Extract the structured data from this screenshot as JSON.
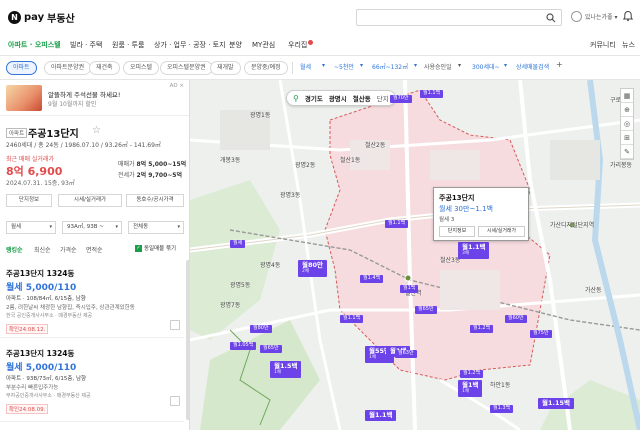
{
  "header": {
    "logo_n": "N",
    "logo_pay": "pay",
    "logo_service": "부동산",
    "search_placeholder": "",
    "user_name": "있나는가좋 ▾"
  },
  "nav": {
    "items": [
      "아파트 · 오피스텔",
      "빌라 · 주택",
      "원룸 · 투룸",
      "상가 · 업무 · 공장 · 토지",
      "분양",
      "MY관심",
      "우리집"
    ],
    "active_index": 0,
    "right": [
      "커뮤니티",
      "뉴스"
    ]
  },
  "filters": {
    "chips": [
      "아파트",
      "아파트분양권",
      "재건축",
      "오피스텔",
      "오피스텔분양권",
      "재개발",
      "분양중/예정"
    ],
    "active_chip": 0,
    "trade": "월세",
    "price": "~5천만",
    "area": "66㎡~132㎡",
    "approval": "사용승인일",
    "households": "300세대~",
    "more": "상세매물검색",
    "plus": "+"
  },
  "ad": {
    "title": "알뜰하게 주석선물 하세요!",
    "subtitle": "9월 10월까지 할인",
    "tag": "AD ×"
  },
  "complex": {
    "badge": "아파트",
    "name": "주공13단지",
    "star": "☆",
    "info": "2460세대 / 총 24동 / 1986.07.10 / 93.26㎡ - 141.69㎡",
    "recent_label": "최근 매매 실거래가",
    "recent_price": "8억 6,900",
    "recent_date": "2024.07.31. 15층, 93㎡",
    "sale_label": "매매가",
    "sale_value": "8억 5,000~15억",
    "lease_label": "전세가",
    "lease_value": "2억 9,700~5억",
    "buttons": [
      "단지정보",
      "시세/실거래가",
      "동호수/공시가격"
    ]
  },
  "selectors": {
    "type": "월세",
    "area": "93A㎡, 93B ~",
    "dong": "전체동"
  },
  "sort_tabs": [
    "랭킹순",
    "최신순",
    "가격순",
    "면적순"
  ],
  "group_label": "동일매물 묶기",
  "listings": [
    {
      "title": "주공13단지 1324동",
      "price": "월세 5,000/110",
      "line1": "아파트 · 108/84㎡, 6/15층, 남향",
      "line2": "2룸, 려한날씨 채광한 남향집, 즉시입주, 상관관계있한동",
      "line3": "한국 공인중개사사무소 · 매경부동산 제공",
      "confirm": "확인24.08.12."
    },
    {
      "title": "주공13단지 1324동",
      "price": "월세 5,000/110",
      "line1": "아파트 · 93B/73㎡, 6/15층, 남향",
      "line2": "부분수리 빠른입주가능",
      "line3": "부자공인중개사사무소 · 매경부동산 제공",
      "confirm": "확인24.08.09."
    }
  ],
  "map": {
    "address": [
      "경기도",
      "광명시",
      "철산동"
    ],
    "address_extra": "단지",
    "tools": [
      "▦",
      "⊕",
      "◎",
      "⊞",
      "✎"
    ],
    "labels": [
      {
        "name": "map-label",
        "text": "광명1동",
        "cls": "t"
      },
      {
        "name": "map-label",
        "text": "광명2동",
        "cls": "t"
      },
      {
        "name": "map-label",
        "text": "광명3동",
        "cls": "t"
      },
      {
        "name": "map-label",
        "text": "광명4동",
        "cls": "t"
      },
      {
        "name": "map-label",
        "text": "광명5동",
        "cls": "t"
      },
      {
        "name": "map-label",
        "text": "광명7동",
        "cls": "t"
      },
      {
        "name": "map-label",
        "text": "철산1동",
        "cls": "t"
      },
      {
        "name": "map-label",
        "text": "철산2동",
        "cls": "t"
      },
      {
        "name": "map-label",
        "text": "철산3동",
        "cls": "t"
      },
      {
        "name": "map-label",
        "text": "하안1동",
        "cls": "t"
      },
      {
        "name": "map-label",
        "text": "하안2동",
        "cls": "t"
      },
      {
        "name": "map-label",
        "text": "가리봉동",
        "cls": "t"
      },
      {
        "name": "map-label",
        "text": "가산동",
        "cls": "t"
      },
      {
        "name": "map-label",
        "text": "구로3동",
        "cls": "t"
      },
      {
        "name": "map-label",
        "text": "개봉3동",
        "cls": "t"
      },
      {
        "name": "map-label",
        "text": "철산역",
        "cls": "t"
      },
      {
        "name": "map-label",
        "text": "가산디지털단지역",
        "cls": "t"
      }
    ],
    "popup": {
      "title": "주공13단지",
      "price": "월세 30만~1.1백",
      "count": "월세 3",
      "buttons": [
        "단지정보",
        "시세/실거래가"
      ]
    },
    "markers": [
      {
        "text": "월세",
        "sub": "",
        "big": false
      },
      {
        "text": "월80만",
        "sub": "2채",
        "big": true
      },
      {
        "text": "월1.1백",
        "sub": "3채",
        "big": true
      },
      {
        "text": "월55만",
        "sub": "1채",
        "big": true
      },
      {
        "text": "월1백",
        "sub": "",
        "big": true
      },
      {
        "text": "월1.5백",
        "sub": "1채",
        "big": true
      },
      {
        "text": "월1백",
        "sub": "1채",
        "big": true
      },
      {
        "text": "월1.15백",
        "sub": "",
        "big": true
      },
      {
        "text": "월1.1백",
        "sub": "",
        "big": true
      },
      {
        "text": "월70만",
        "sub": "",
        "big": false
      },
      {
        "text": "월1.1백",
        "sub": "",
        "big": false
      },
      {
        "text": "월1.1백",
        "sub": "",
        "big": false
      },
      {
        "text": "월1.4백",
        "sub": "",
        "big": false
      },
      {
        "text": "월65만",
        "sub": "",
        "big": false
      },
      {
        "text": "월1.1백",
        "sub": "",
        "big": false
      },
      {
        "text": "월1.2백",
        "sub": "",
        "big": false
      },
      {
        "text": "월80만",
        "sub": "",
        "big": false
      },
      {
        "text": "월65만",
        "sub": "",
        "big": false
      },
      {
        "text": "월1.05백",
        "sub": "",
        "big": false
      },
      {
        "text": "월60만",
        "sub": "",
        "big": false
      },
      {
        "text": "월75만",
        "sub": "",
        "big": false
      },
      {
        "text": "월1.3백",
        "sub": "",
        "big": false
      },
      {
        "text": "월63만",
        "sub": "",
        "big": false
      },
      {
        "text": "월1.2백",
        "sub": "",
        "big": false
      },
      {
        "text": "월1백",
        "sub": "",
        "big": false
      }
    ],
    "colors": {
      "district_fill": "#f7d9dc",
      "district_border": "#d65a5a",
      "road": "#ffffff",
      "park": "#d9ecd0",
      "marker": "#6b43e8"
    }
  }
}
